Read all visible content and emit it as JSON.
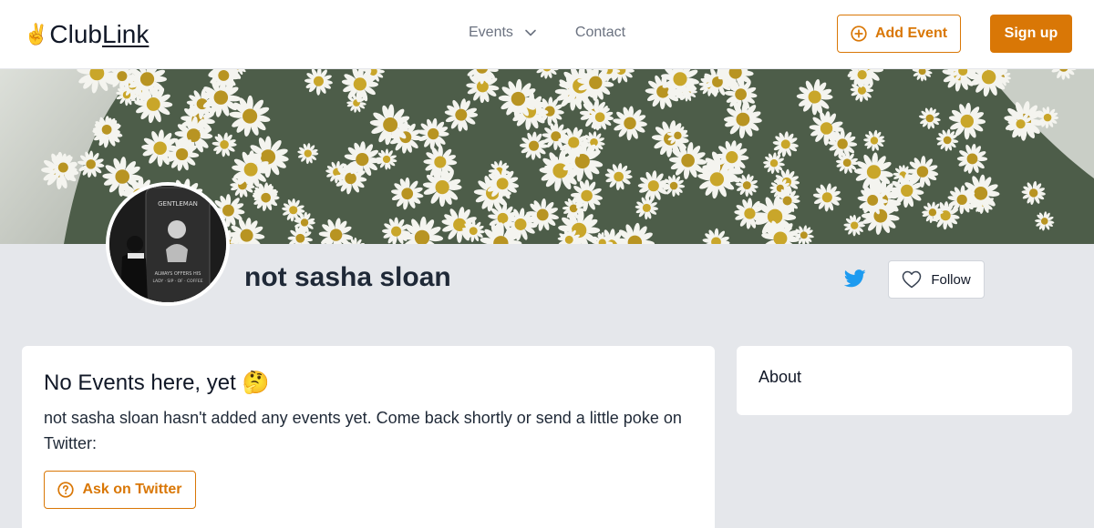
{
  "header": {
    "logo_emoji": "✌",
    "logo_club": "Club",
    "logo_link": "Link",
    "nav": {
      "events_label": "Events",
      "contact_label": "Contact"
    },
    "add_event_label": "Add Event",
    "signup_label": "Sign up"
  },
  "profile": {
    "name": "not sasha sloan",
    "follow_label": "Follow"
  },
  "main": {
    "title": "No Events here, yet 🤔",
    "message": "not sasha sloan hasn't added any events yet. Come back shortly or send a little poke on Twitter:",
    "ask_label": "Ask on Twitter"
  },
  "about": {
    "title": "About"
  },
  "avatar_image": {
    "line1": "GENTLEMAN",
    "line2": "ALWAYS OFFERS HIS",
    "line3": "LADY · SIP · OF · COFFEE"
  },
  "colors": {
    "accent": "#d97706",
    "twitter": "#1d9bf0",
    "page_bg": "#e5e7eb"
  }
}
